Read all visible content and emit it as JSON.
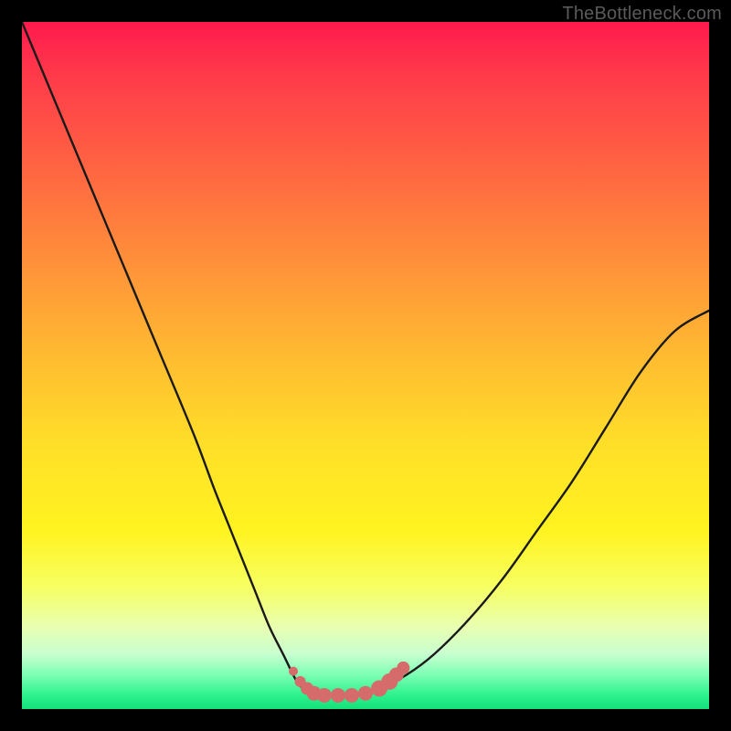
{
  "watermark": "TheBottleneck.com",
  "colors": {
    "background": "#000000",
    "curve_stroke": "#1a1a1a",
    "marker_fill": "#d66b6b",
    "gradient_top": "#ff1a4d",
    "gradient_bottom": "#14e07a"
  },
  "chart_data": {
    "type": "line",
    "title": "",
    "xlabel": "",
    "ylabel": "",
    "xlim": [
      0,
      100
    ],
    "ylim": [
      0,
      100
    ],
    "grid": false,
    "legend": false,
    "annotations": [],
    "x": [
      0,
      5,
      10,
      15,
      20,
      25,
      28,
      30,
      32,
      34,
      36,
      38,
      40,
      41,
      42,
      43,
      45,
      47,
      50,
      53,
      56,
      60,
      65,
      70,
      75,
      80,
      85,
      90,
      95,
      100
    ],
    "values": [
      100,
      88,
      76,
      64,
      52,
      40,
      32,
      27,
      22,
      17,
      12,
      8,
      4,
      3,
      2.5,
      2,
      2,
      2,
      2.5,
      3.5,
      5,
      8,
      13,
      19,
      26,
      33,
      41,
      49,
      55,
      58
    ],
    "series": [
      {
        "name": "bottleneck-curve",
        "x": [
          0,
          5,
          10,
          15,
          20,
          25,
          28,
          30,
          32,
          34,
          36,
          38,
          40,
          41,
          42,
          43,
          45,
          47,
          50,
          53,
          56,
          60,
          65,
          70,
          75,
          80,
          85,
          90,
          95,
          100
        ],
        "y": [
          100,
          88,
          76,
          64,
          52,
          40,
          32,
          27,
          22,
          17,
          12,
          8,
          4,
          3,
          2.5,
          2,
          2,
          2,
          2.5,
          3.5,
          5,
          8,
          13,
          19,
          26,
          33,
          41,
          49,
          55,
          58
        ]
      }
    ],
    "markers": {
      "name": "highlighted-points",
      "color": "#d66b6b",
      "x": [
        39.5,
        40.5,
        41.5,
        42.5,
        44.0,
        46.0,
        48.0,
        50.0,
        52.0,
        53.5,
        54.5,
        55.5
      ],
      "y": [
        5.5,
        4.0,
        3.0,
        2.3,
        2.0,
        2.0,
        2.0,
        2.3,
        3.0,
        4.0,
        5.0,
        6.0
      ],
      "sizes": [
        5,
        6,
        7,
        8,
        8,
        8,
        8,
        8,
        9,
        9,
        8,
        7
      ]
    }
  }
}
